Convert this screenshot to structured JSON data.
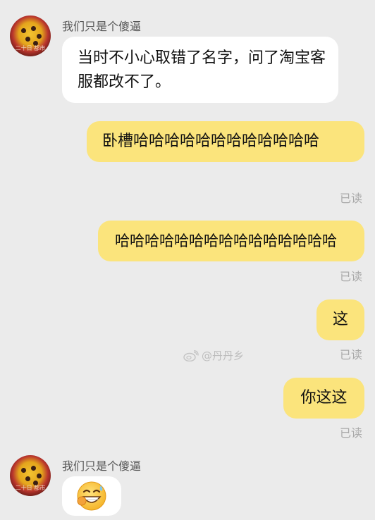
{
  "contact": {
    "name": "我们只是个傻逼",
    "avatar_caption": "二十日 都市"
  },
  "messages": {
    "m1": "当时不小心取错了名字，问了淘宝客服都改不了。",
    "m2": "卧槽哈哈哈哈哈哈哈哈哈哈哈哈",
    "m3": "哈哈哈哈哈哈哈哈哈哈哈哈哈哈哈",
    "m4": "这",
    "m5": "你这这"
  },
  "read_label": "已读",
  "watermark": {
    "text": "@丹丹乡",
    "icon": "weibo-icon"
  },
  "last_message_icon": "grinning-sweat-emoji-icon",
  "colors": {
    "background": "#ebebeb",
    "incoming_bubble": "#ffffff",
    "outgoing_bubble": "#fbe47c",
    "read_receipt": "#a9a9a9"
  }
}
